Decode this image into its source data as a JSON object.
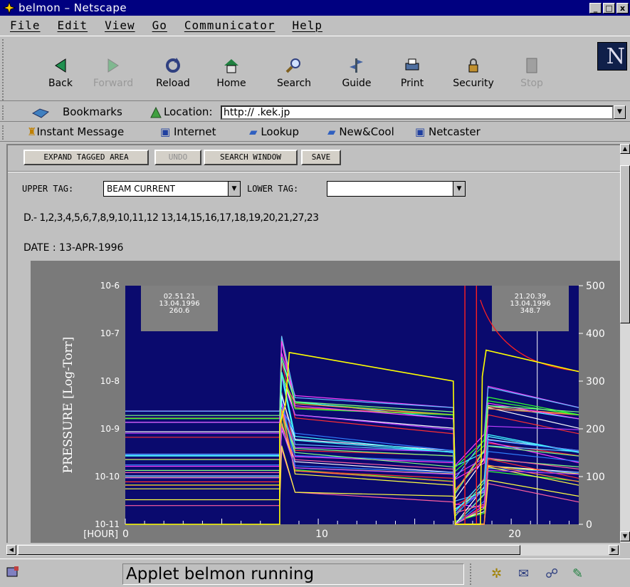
{
  "window": {
    "title": "belmon – Netscape",
    "min": "_",
    "max": "□",
    "close": "x"
  },
  "menu": [
    "File",
    "Edit",
    "View",
    "Go",
    "Communicator",
    "Help"
  ],
  "toolbar": [
    {
      "label": "Back",
      "icon": "back-icon",
      "enabled": true
    },
    {
      "label": "Forward",
      "icon": "forward-icon",
      "enabled": false
    },
    {
      "label": "Reload",
      "icon": "reload-icon",
      "enabled": true
    },
    {
      "label": "Home",
      "icon": "home-icon",
      "enabled": true
    },
    {
      "label": "Search",
      "icon": "search-icon",
      "enabled": true
    },
    {
      "label": "Guide",
      "icon": "guide-icon",
      "enabled": true
    },
    {
      "label": "Print",
      "icon": "print-icon",
      "enabled": true
    },
    {
      "label": "Security",
      "icon": "security-icon",
      "enabled": true
    },
    {
      "label": "Stop",
      "icon": "stop-icon",
      "enabled": false
    }
  ],
  "logo": "N",
  "location": {
    "bookmarks": "Bookmarks",
    "label": "Location:",
    "url": "http://          .kek.jp"
  },
  "personal": [
    "Instant Message",
    "Internet",
    "Lookup",
    "New&Cool",
    "Netcaster"
  ],
  "applet": {
    "buttons": [
      "EXPAND TAGGED AREA",
      "UNDO",
      "SEARCH WINDOW",
      "SAVE"
    ],
    "upper_tag_label": "UPPER TAG:",
    "upper_tag_value": "BEAM CURRENT",
    "lower_tag_label": "LOWER TAG:",
    "lower_tag_value": "",
    "d_line": "D.- 1,2,3,4,5,6,7,8,9,10,11,12 13,14,15,16,17,18,19,20,21,27,23",
    "date_line": "DATE : 13-APR-1996"
  },
  "status": {
    "text": "Applet belmon running"
  },
  "chart_data": {
    "type": "line",
    "ylabel": "PRESSURE [Log-Torr]",
    "xlabel": "[HOUR]",
    "y_left_ticks": [
      "10-6",
      "10-7",
      "10-8",
      "10-9",
      "10-10",
      "10-11"
    ],
    "y_right_ticks": [
      "500",
      "400",
      "300",
      "200",
      "100",
      "0"
    ],
    "x_ticks": [
      "0",
      "10",
      "20"
    ],
    "xlim": [
      0,
      23.5
    ],
    "y_right_lim": [
      0,
      500
    ],
    "colors": {
      "background": "#0a0a6e",
      "beam": "#ffff00",
      "red": "#ff2020"
    },
    "annotations": [
      {
        "time": "02.51.21",
        "date": "13.04.1996",
        "value": "260.6"
      },
      {
        "time": "21.20.39",
        "date": "13.04.1996",
        "value": "348.7"
      }
    ],
    "beam_current": [
      {
        "x": 0,
        "y": 0
      },
      {
        "x": 8.0,
        "y": 0
      },
      {
        "x": 8.0,
        "y": 210
      },
      {
        "x": 8.3,
        "y": 250
      },
      {
        "x": 8.5,
        "y": 360
      },
      {
        "x": 17.0,
        "y": 300
      },
      {
        "x": 17.1,
        "y": 0
      },
      {
        "x": 18.4,
        "y": 0
      },
      {
        "x": 18.5,
        "y": 310
      },
      {
        "x": 18.7,
        "y": 365
      },
      {
        "x": 23.5,
        "y": 320
      }
    ]
  }
}
